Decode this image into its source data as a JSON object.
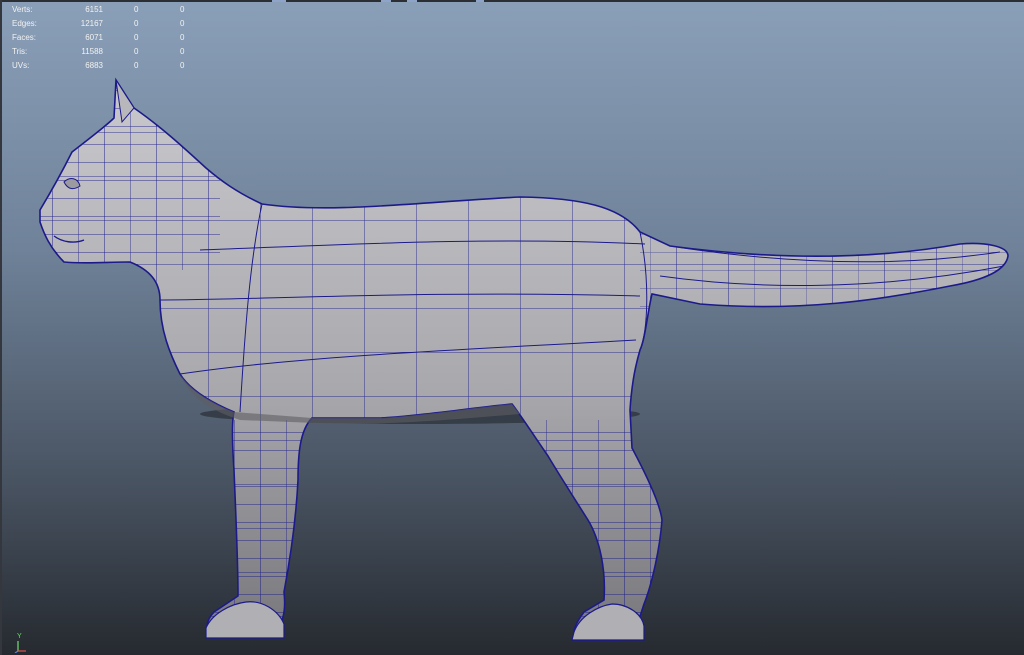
{
  "hud": {
    "rows": [
      {
        "label": "Verts:",
        "total": "6151",
        "selected": "0",
        "component": "0"
      },
      {
        "label": "Edges:",
        "total": "12167",
        "selected": "0",
        "component": "0"
      },
      {
        "label": "Faces:",
        "total": "6071",
        "selected": "0",
        "component": "0"
      },
      {
        "label": "Tris:",
        "total": "11588",
        "selected": "0",
        "component": "0"
      },
      {
        "label": "UVs:",
        "total": "6883",
        "selected": "0",
        "component": "0"
      }
    ]
  },
  "axis": {
    "y_label": "Y"
  },
  "colors": {
    "wire": "#1c1a8a",
    "shade_light": "#c4c4c8",
    "shade_dark": "#6a6a6e",
    "axis_y": "#6ddf6d",
    "axis_x": "#e05050",
    "axis_z": "#5a80e0"
  },
  "icons": {
    "model": "cat-mesh-icon",
    "axis": "axis-gizmo-icon"
  }
}
